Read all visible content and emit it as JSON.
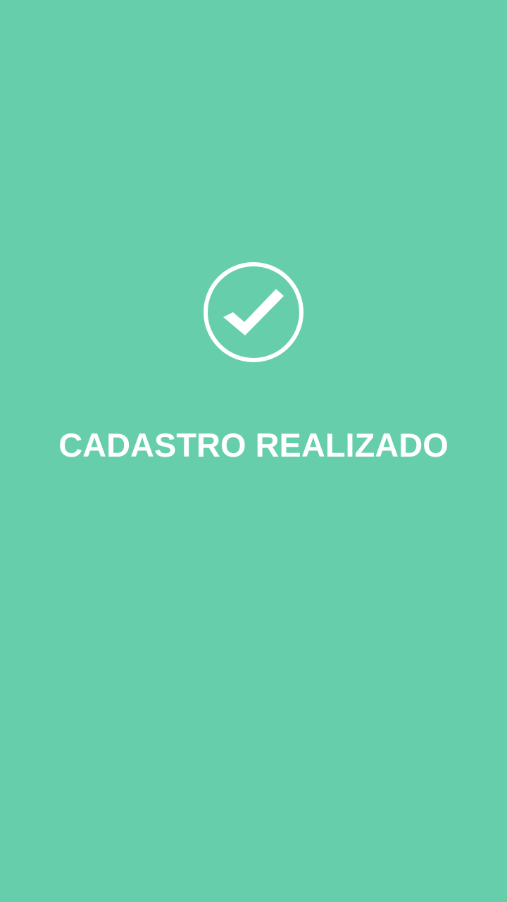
{
  "screen": {
    "background_color": "#66CEAA",
    "foreground_color": "#FFFFFF",
    "icon": "check-circle-icon",
    "message": "CADASTRO REALIZADO"
  }
}
